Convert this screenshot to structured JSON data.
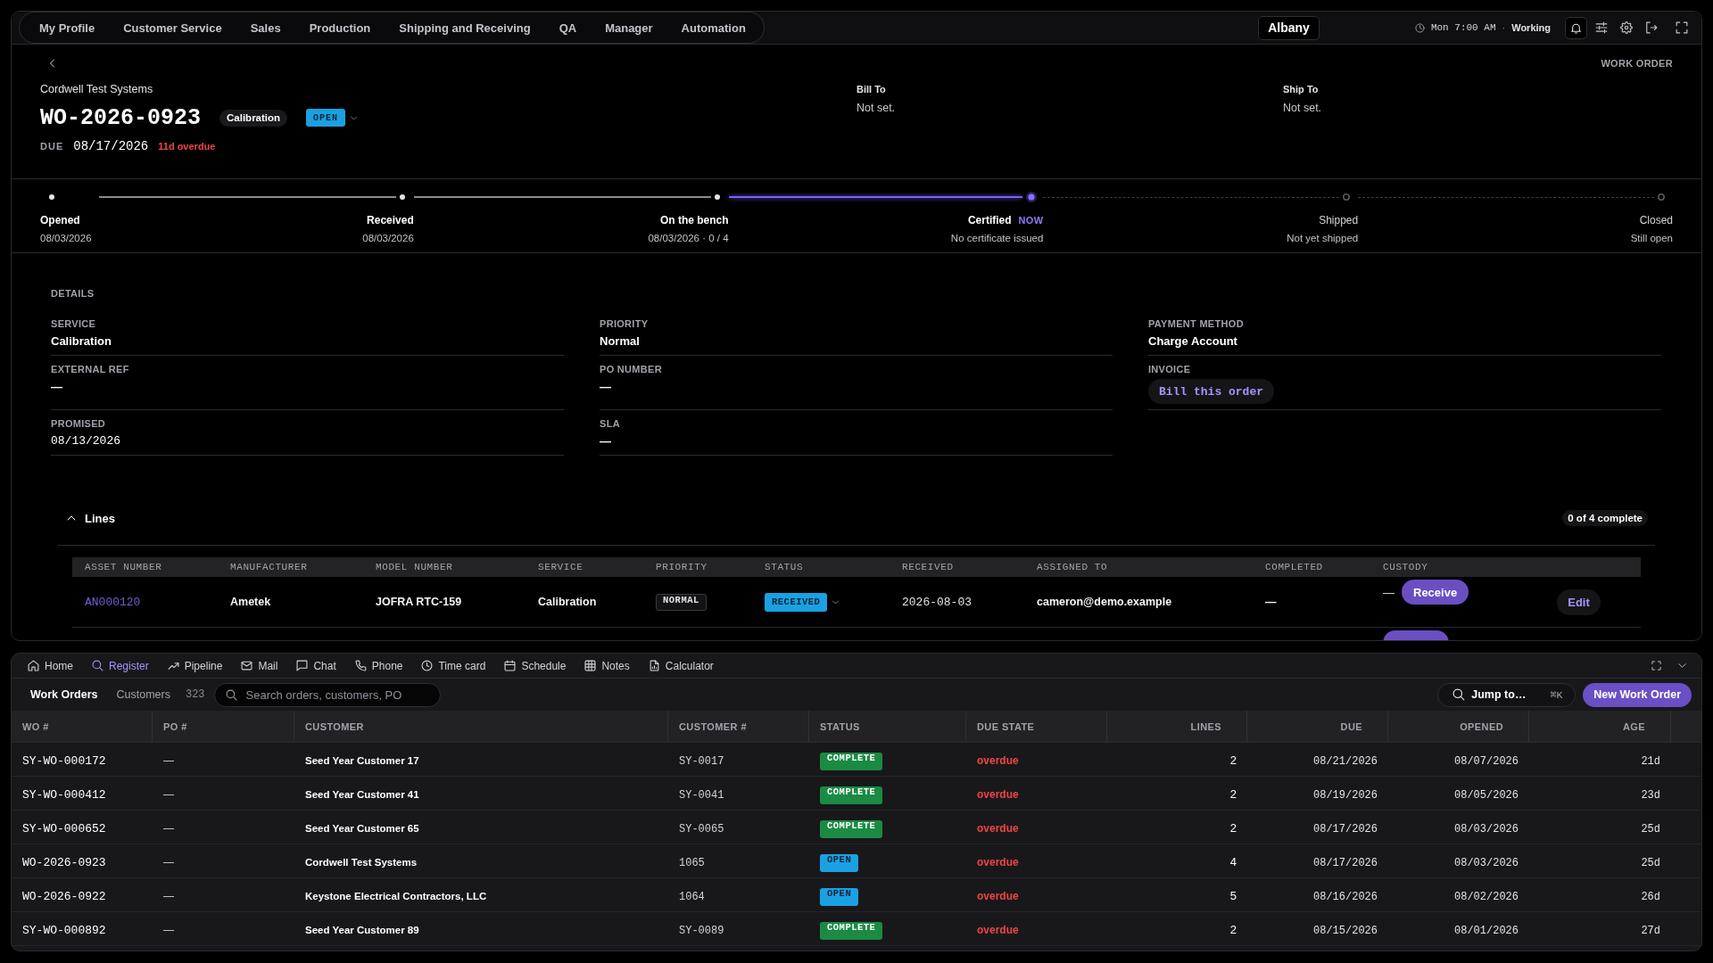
{
  "top_nav": {
    "items": [
      {
        "label": "My Profile"
      },
      {
        "label": "Customer Service"
      },
      {
        "label": "Sales"
      },
      {
        "label": "Production"
      },
      {
        "label": "Shipping and Receiving"
      },
      {
        "label": "QA"
      },
      {
        "label": "Manager"
      },
      {
        "label": "Automation"
      }
    ],
    "location": "Albany",
    "time": "Mon 7:00 AM",
    "separator": "·",
    "shift": "Working"
  },
  "work_order": {
    "kind_label": "WORK ORDER",
    "customer": "Cordwell Test Systems",
    "number": "WO-2026-0923",
    "service": "Calibration",
    "status": {
      "label": "OPEN",
      "color": "#1ba1e2"
    },
    "due_label": "DUE",
    "due": "08/17/2026",
    "overdue": "11d overdue",
    "bill_to": {
      "label": "Bill To",
      "value": "Not set."
    },
    "ship_to": {
      "label": "Ship To",
      "value": "Not set."
    }
  },
  "stepper": [
    {
      "label": "Opened",
      "detail": "08/03/2026",
      "done": true,
      "current": false
    },
    {
      "label": "Received",
      "detail": "08/03/2026",
      "done": true,
      "current": false
    },
    {
      "label": "On the bench",
      "detail": "08/03/2026 · 0 / 4",
      "done": true,
      "current": false
    },
    {
      "label": "Certified",
      "tag": "NOW",
      "detail": "No certificate issued",
      "done": false,
      "current": true
    },
    {
      "label": "Shipped",
      "detail": "Not yet shipped",
      "done": false,
      "current": false
    },
    {
      "label": "Closed",
      "detail": "Still open",
      "done": false,
      "current": false
    }
  ],
  "details": {
    "title": "DETAILS",
    "fields": [
      {
        "label": "SERVICE",
        "value": "Calibration",
        "kind": "text"
      },
      {
        "label": "PRIORITY",
        "value": "Normal",
        "kind": "text"
      },
      {
        "label": "PAYMENT METHOD",
        "value": "Charge Account",
        "kind": "text"
      },
      {
        "label": "EXTERNAL REF",
        "value": "—",
        "kind": "text"
      },
      {
        "label": "PO NUMBER",
        "value": "—",
        "kind": "text"
      },
      {
        "label": "INVOICE",
        "value": "Bill this order",
        "kind": "button"
      },
      {
        "label": "PROMISED",
        "value": "08/13/2026",
        "kind": "date"
      },
      {
        "label": "SLA",
        "value": "—",
        "kind": "text"
      }
    ]
  },
  "lines": {
    "title": "Lines",
    "expanded": true,
    "progress": "0 of 4 complete",
    "columns": [
      "ASSET NUMBER",
      "MANUFACTURER",
      "MODEL NUMBER",
      "SERVICE",
      "PRIORITY",
      "STATUS",
      "RECEIVED",
      "ASSIGNED TO",
      "COMPLETED",
      "CUSTODY"
    ],
    "rows": [
      {
        "asset_number": "AN000120",
        "manufacturer": "Ametek",
        "model_number": "JOFRA RTC-159",
        "service": "Calibration",
        "priority": "NORMAL",
        "status": {
          "label": "RECEIVED",
          "color": "#1ba1e2"
        },
        "received": "2026-08-03",
        "assigned_to": "cameron@demo.example",
        "completed": "—",
        "custody": "—",
        "receive_button": true,
        "custody_action": "Receive",
        "action": "Edit"
      },
      {
        "receive_button": true
      }
    ]
  },
  "dock": {
    "apps": [
      {
        "label": "Home",
        "selected": false
      },
      {
        "label": "Register",
        "selected": true
      },
      {
        "label": "Pipeline",
        "selected": false
      },
      {
        "label": "Mail",
        "selected": false
      },
      {
        "label": "Chat",
        "selected": false
      },
      {
        "label": "Phone",
        "selected": false
      },
      {
        "label": "Time card",
        "selected": false
      },
      {
        "label": "Schedule",
        "selected": false
      },
      {
        "label": "Notes",
        "selected": false
      },
      {
        "label": "Calculator",
        "selected": false
      }
    ],
    "tabs": [
      {
        "label": "Work Orders",
        "selected": true
      },
      {
        "label": "Customers",
        "selected": false
      }
    ],
    "count": "323",
    "search": {
      "placeholder": "Search orders, customers, PO"
    },
    "jump": {
      "label": "Jump to…",
      "shortcut": "⌘K"
    },
    "new_button": "New Work Order",
    "table": {
      "columns": [
        "WO #",
        "PO #",
        "CUSTOMER",
        "CUSTOMER #",
        "STATUS",
        "DUE STATE",
        "LINES",
        "DUE",
        "OPENED",
        "AGE"
      ],
      "rows": [
        {
          "wo": "SY-WO-000172",
          "po": "—",
          "customer": "Seed Year Customer 17",
          "customer_number": "SY-0017",
          "status": {
            "label": "COMPLETE",
            "color": "#1b8a43"
          },
          "due_state": "overdue",
          "lines": "2",
          "due": "08/21/2026",
          "opened": "08/07/2026",
          "age": "21d"
        },
        {
          "wo": "SY-WO-000412",
          "po": "—",
          "customer": "Seed Year Customer 41",
          "customer_number": "SY-0041",
          "status": {
            "label": "COMPLETE",
            "color": "#1b8a43"
          },
          "due_state": "overdue",
          "lines": "2",
          "due": "08/19/2026",
          "opened": "08/05/2026",
          "age": "23d"
        },
        {
          "wo": "SY-WO-000652",
          "po": "—",
          "customer": "Seed Year Customer 65",
          "customer_number": "SY-0065",
          "status": {
            "label": "COMPLETE",
            "color": "#1b8a43"
          },
          "due_state": "overdue",
          "lines": "2",
          "due": "08/17/2026",
          "opened": "08/03/2026",
          "age": "25d"
        },
        {
          "wo": "WO-2026-0923",
          "po": "—",
          "customer": "Cordwell Test Systems",
          "customer_number": "1065",
          "status": {
            "label": "OPEN",
            "color": "#1ba1e2"
          },
          "due_state": "overdue",
          "lines": "4",
          "due": "08/17/2026",
          "opened": "08/03/2026",
          "age": "25d"
        },
        {
          "wo": "WO-2026-0922",
          "po": "—",
          "customer": "Keystone Electrical Contractors, LLC",
          "customer_number": "1064",
          "status": {
            "label": "OPEN",
            "color": "#1ba1e2"
          },
          "due_state": "overdue",
          "lines": "5",
          "due": "08/16/2026",
          "opened": "08/02/2026",
          "age": "26d"
        },
        {
          "wo": "SY-WO-000892",
          "po": "—",
          "customer": "Seed Year Customer 89",
          "customer_number": "SY-0089",
          "status": {
            "label": "COMPLETE",
            "color": "#1b8a43"
          },
          "due_state": "overdue",
          "lines": "2",
          "due": "08/15/2026",
          "opened": "08/01/2026",
          "age": "27d"
        }
      ]
    }
  }
}
